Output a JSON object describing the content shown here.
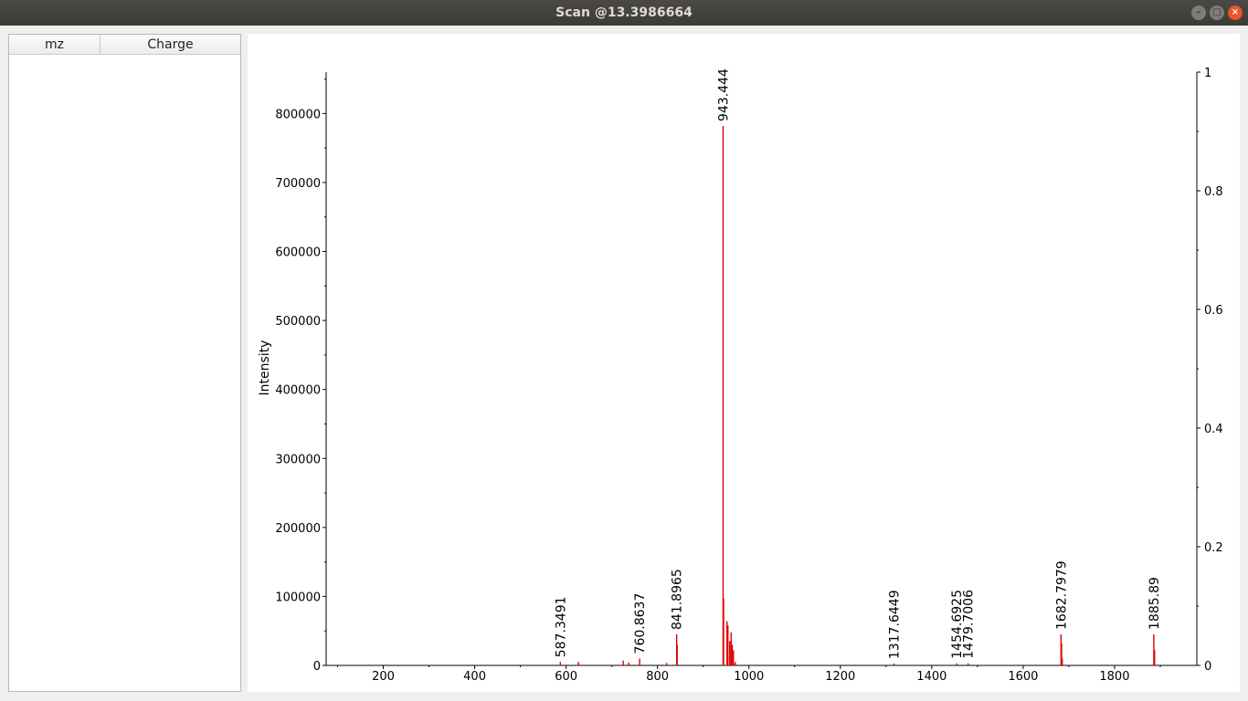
{
  "window": {
    "title": "Scan @13.3986664",
    "buttons": [
      "minimize-icon",
      "maximize-icon",
      "close-icon"
    ]
  },
  "table": {
    "columns": [
      "mz",
      "Charge"
    ],
    "rows": []
  },
  "chart_data": {
    "type": "bar",
    "ylabel": "Intensity",
    "xlim": [
      75,
      1980
    ],
    "ylim": [
      0,
      860000
    ],
    "y2lim": [
      0,
      1
    ],
    "x_ticks": [
      200,
      400,
      600,
      800,
      1000,
      1200,
      1400,
      1600,
      1800
    ],
    "y_ticks": [
      0,
      100000,
      200000,
      300000,
      400000,
      500000,
      600000,
      700000,
      800000
    ],
    "y2_ticks": [
      0,
      0.2,
      0.4,
      0.6,
      0.8,
      1
    ],
    "peak_color": "#dd0000",
    "peaks": [
      {
        "mz": 587.3491,
        "intensity": 5000
      },
      {
        "mz": 627.0,
        "intensity": 5000
      },
      {
        "mz": 725.0,
        "intensity": 7000
      },
      {
        "mz": 737.0,
        "intensity": 4000
      },
      {
        "mz": 760.8637,
        "intensity": 10000
      },
      {
        "mz": 820.0,
        "intensity": 3500
      },
      {
        "mz": 841.8965,
        "intensity": 45000
      },
      {
        "mz": 843.0,
        "intensity": 30000
      },
      {
        "mz": 943.444,
        "intensity": 782000
      },
      {
        "mz": 944.5,
        "intensity": 97000
      },
      {
        "mz": 952.0,
        "intensity": 64000
      },
      {
        "mz": 954.0,
        "intensity": 58000
      },
      {
        "mz": 958.0,
        "intensity": 35000
      },
      {
        "mz": 961.0,
        "intensity": 48000
      },
      {
        "mz": 963.5,
        "intensity": 30000
      },
      {
        "mz": 966.0,
        "intensity": 22000
      },
      {
        "mz": 970.0,
        "intensity": 5000
      },
      {
        "mz": 1317.6449,
        "intensity": 2500
      },
      {
        "mz": 1454.6925,
        "intensity": 3000
      },
      {
        "mz": 1479.7006,
        "intensity": 3000
      },
      {
        "mz": 1682.7979,
        "intensity": 45000
      },
      {
        "mz": 1684.0,
        "intensity": 32000
      },
      {
        "mz": 1685.5,
        "intensity": 10000
      },
      {
        "mz": 1885.89,
        "intensity": 45000
      },
      {
        "mz": 1887.5,
        "intensity": 22000
      }
    ],
    "peak_labels": [
      {
        "mz": 587.3491,
        "intensity": 5000,
        "text": "587.3491"
      },
      {
        "mz": 760.8637,
        "intensity": 10000,
        "text": "760.8637"
      },
      {
        "mz": 841.8965,
        "intensity": 45000,
        "text": "841.8965"
      },
      {
        "mz": 943.444,
        "intensity": 782000,
        "text": "943.444"
      },
      {
        "mz": 1317.6449,
        "intensity": 2500,
        "text": "1317.6449"
      },
      {
        "mz": 1454.6925,
        "intensity": 3000,
        "text": "1454.6925"
      },
      {
        "mz": 1479.7006,
        "intensity": 3000,
        "text": "1479.7006"
      },
      {
        "mz": 1682.7979,
        "intensity": 45000,
        "text": "1682.7979"
      },
      {
        "mz": 1885.89,
        "intensity": 45000,
        "text": "1885.89"
      }
    ]
  }
}
